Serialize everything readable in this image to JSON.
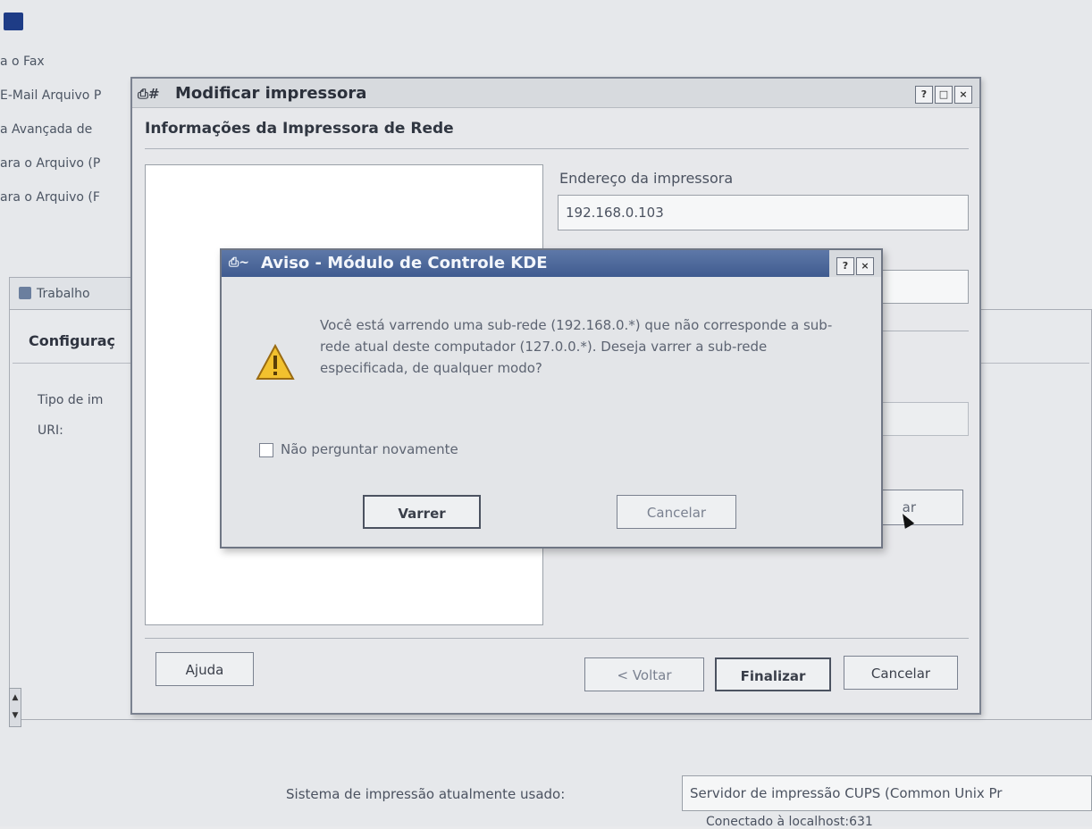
{
  "background": {
    "menu_items": [
      "a o Fax",
      "E-Mail Arquivo P",
      "a Avançada de",
      "ara o Arquivo (P",
      "ara o Arquivo (F"
    ],
    "tab_label": "Trabalho",
    "panel_title": "Configuraç",
    "type_label": "Tipo de im",
    "uri_label": "URI:",
    "print_system_label": "Sistema de impressão atualmente usado:",
    "print_system_value": "Servidor de impressão CUPS (Common Unix Pr",
    "connected_text": "Conectado à localhost:631"
  },
  "main_dialog": {
    "title": "Modificar impressora",
    "title_icon": "printer-icon",
    "header": "Informações da Impressora de Rede",
    "address_label": "Endereço da impressora",
    "address_value": "192.168.0.103",
    "scan_button_fragment": "ar",
    "buttons": {
      "help": "Ajuda",
      "back": "< Voltar",
      "finish": "Finalizar",
      "cancel": "Cancelar"
    },
    "titlebar_buttons": [
      "?",
      "□",
      "×"
    ]
  },
  "warning_dialog": {
    "title": "Aviso - Módulo de Controle KDE",
    "message": "Você está varrendo uma sub-rede (192.168.0.*) que não corresponde a sub-rede atual deste computador (127.0.0.*). Deseja varrer a sub-rede especificada, de qualquer modo?",
    "checkbox_label": "Não perguntar novamente",
    "checkbox_checked": false,
    "buttons": {
      "scan": "Varrer",
      "cancel": "Cancelar"
    },
    "titlebar_buttons": [
      "?",
      "×"
    ]
  },
  "colors": {
    "titlebar_active": "#3f5b8f",
    "warning_yellow": "#f2c12e"
  }
}
